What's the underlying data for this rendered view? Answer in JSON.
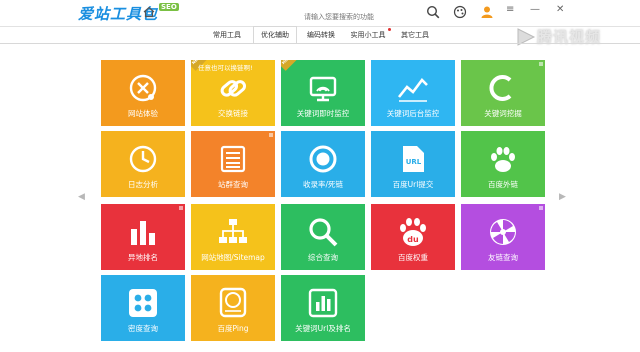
{
  "header": {
    "brand": "爱站工具包",
    "brand_badge": "SEO",
    "search": {
      "placeholder": "请输入您要搜索的功能"
    }
  },
  "tabs": [
    {
      "label": "常用工具"
    },
    {
      "label": "优化辅助"
    },
    {
      "label": "编码转换"
    },
    {
      "label": "实用小工具"
    },
    {
      "label": "其它工具"
    }
  ],
  "active_tab": "优化辅助",
  "watermark": "腾讯视频",
  "tooltip": "任意也可以换链啊!",
  "tiles": [
    {
      "label": "网站体验",
      "color": "#f39a1e",
      "icon": "stethoscope-icon"
    },
    {
      "label": "交换链接",
      "color": "#f5c21b",
      "icon": "link-icon",
      "ribbon": "NEW"
    },
    {
      "label": "关键词即时监控",
      "color": "#2dbe60",
      "icon": "monitor-icon",
      "ribbon": "HOT"
    },
    {
      "label": "关键词后台监控",
      "color": "#2fb6f2",
      "icon": "line-chart-icon"
    },
    {
      "label": "关键词挖掘",
      "color": "#6ac54a",
      "icon": "c-letter-icon"
    },
    {
      "label": "日志分析",
      "color": "#f5b21e",
      "icon": "clock-icon"
    },
    {
      "label": "站群查询",
      "color": "#f3832a",
      "icon": "list-icon"
    },
    {
      "label": "收录率/死链",
      "color": "#2aaee8",
      "icon": "circle-target-icon"
    },
    {
      "label": "百度Url提交",
      "color": "#2aaee8",
      "icon": "url-file-icon"
    },
    {
      "label": "百度外链",
      "color": "#52c44a",
      "icon": "paw-icon"
    },
    {
      "label": "异地排名",
      "color": "#e8323c",
      "icon": "bar-chart-icon"
    },
    {
      "label": "网站地图/Sitemap",
      "color": "#f5c21b",
      "icon": "sitemap-icon"
    },
    {
      "label": "综合查询",
      "color": "#2dbe60",
      "icon": "magnifier-icon"
    },
    {
      "label": "百度权重",
      "color": "#e8323c",
      "icon": "baidu-paw-icon",
      "icon_text": "du"
    },
    {
      "label": "友链查询",
      "color": "#b44ee0",
      "icon": "pinwheel-icon"
    },
    {
      "label": "密度查询",
      "color": "#2aaee8",
      "icon": "grid-dots-icon"
    },
    {
      "label": "百度Ping",
      "color": "#f5b21e",
      "icon": "ping-icon"
    },
    {
      "label": "关键词Url及排名",
      "color": "#2dbe60",
      "icon": "chart-box-icon"
    }
  ]
}
